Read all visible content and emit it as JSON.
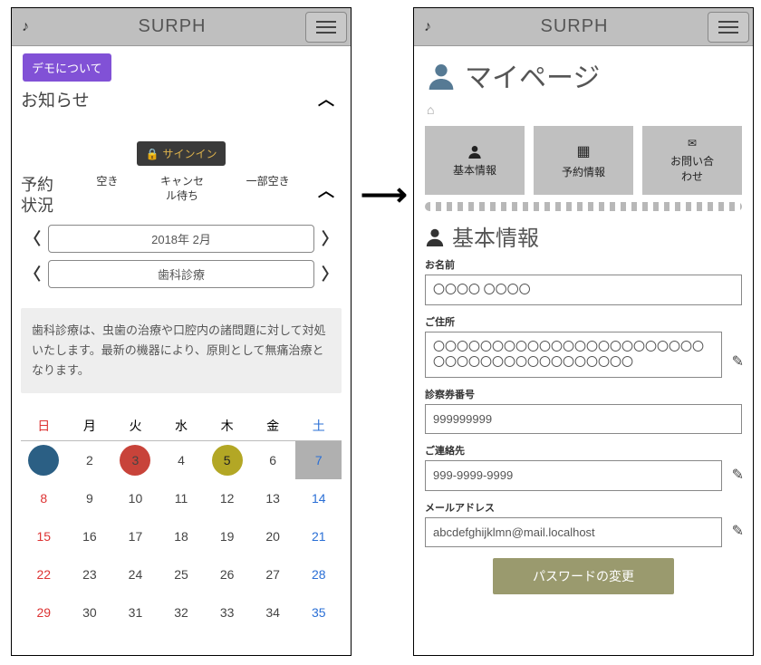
{
  "header": {
    "brand": "SURPH"
  },
  "left": {
    "demo_button": "デモについて",
    "news_title": "お知らせ",
    "signin": "サインイン",
    "status_title_l1": "予約",
    "status_title_l2": "状況",
    "legend": {
      "a": "空き",
      "b1": "キャンセ",
      "b2": "ル待ち",
      "c": "一部空き"
    },
    "month_label": "2018年 2月",
    "dept_label": "歯科診療",
    "description": "歯科診療は、虫歯の治療や口腔内の諸問題に対して対処いたします。最新の機器により、原則として無痛治療となります。",
    "weekdays": [
      "日",
      "月",
      "火",
      "水",
      "木",
      "金",
      "土"
    ],
    "calendar": [
      [
        {
          "n": "",
          "cls": "sun",
          "circ": "c-blue"
        },
        {
          "n": "2"
        },
        {
          "n": "3",
          "circ": "c-red"
        },
        {
          "n": "4"
        },
        {
          "n": "5",
          "circ": "c-olive",
          "oncolor": true
        },
        {
          "n": "6"
        },
        {
          "n": "7",
          "cls": "sat",
          "grey": true
        }
      ],
      [
        {
          "n": "8",
          "cls": "sun"
        },
        {
          "n": "9"
        },
        {
          "n": "10"
        },
        {
          "n": "11"
        },
        {
          "n": "12"
        },
        {
          "n": "13"
        },
        {
          "n": "14",
          "cls": "sat"
        }
      ],
      [
        {
          "n": "15",
          "cls": "sun"
        },
        {
          "n": "16"
        },
        {
          "n": "17"
        },
        {
          "n": "18"
        },
        {
          "n": "19"
        },
        {
          "n": "20"
        },
        {
          "n": "21",
          "cls": "sat"
        }
      ],
      [
        {
          "n": "22",
          "cls": "sun"
        },
        {
          "n": "23"
        },
        {
          "n": "24"
        },
        {
          "n": "25"
        },
        {
          "n": "26"
        },
        {
          "n": "27"
        },
        {
          "n": "28",
          "cls": "sat"
        }
      ],
      [
        {
          "n": "29",
          "cls": "sun"
        },
        {
          "n": "30"
        },
        {
          "n": "31"
        },
        {
          "n": "32"
        },
        {
          "n": "33"
        },
        {
          "n": "34"
        },
        {
          "n": "35",
          "cls": "sat"
        }
      ]
    ]
  },
  "right": {
    "page_title": "マイページ",
    "cards": {
      "a": "基本情報",
      "b": "予約情報",
      "c1": "お問い合",
      "c2": "わせ"
    },
    "section_title": "基本情報",
    "fields": {
      "name_label": "お名前",
      "name_val": "〇〇〇〇 〇〇〇〇",
      "addr_label": "ご住所",
      "addr_val": "〇〇〇〇〇〇〇〇〇〇〇〇〇〇〇〇〇〇〇〇〇〇〇〇〇〇〇〇〇〇〇〇〇〇〇〇〇〇〇〇",
      "ticket_label": "診察券番号",
      "ticket_val": "999999999",
      "contact_label": "ご連絡先",
      "contact_val": "999-9999-9999",
      "mail_label": "メールアドレス",
      "mail_val": "abcdefghijklmn@mail.localhost"
    },
    "password_button": "パスワードの変更"
  }
}
